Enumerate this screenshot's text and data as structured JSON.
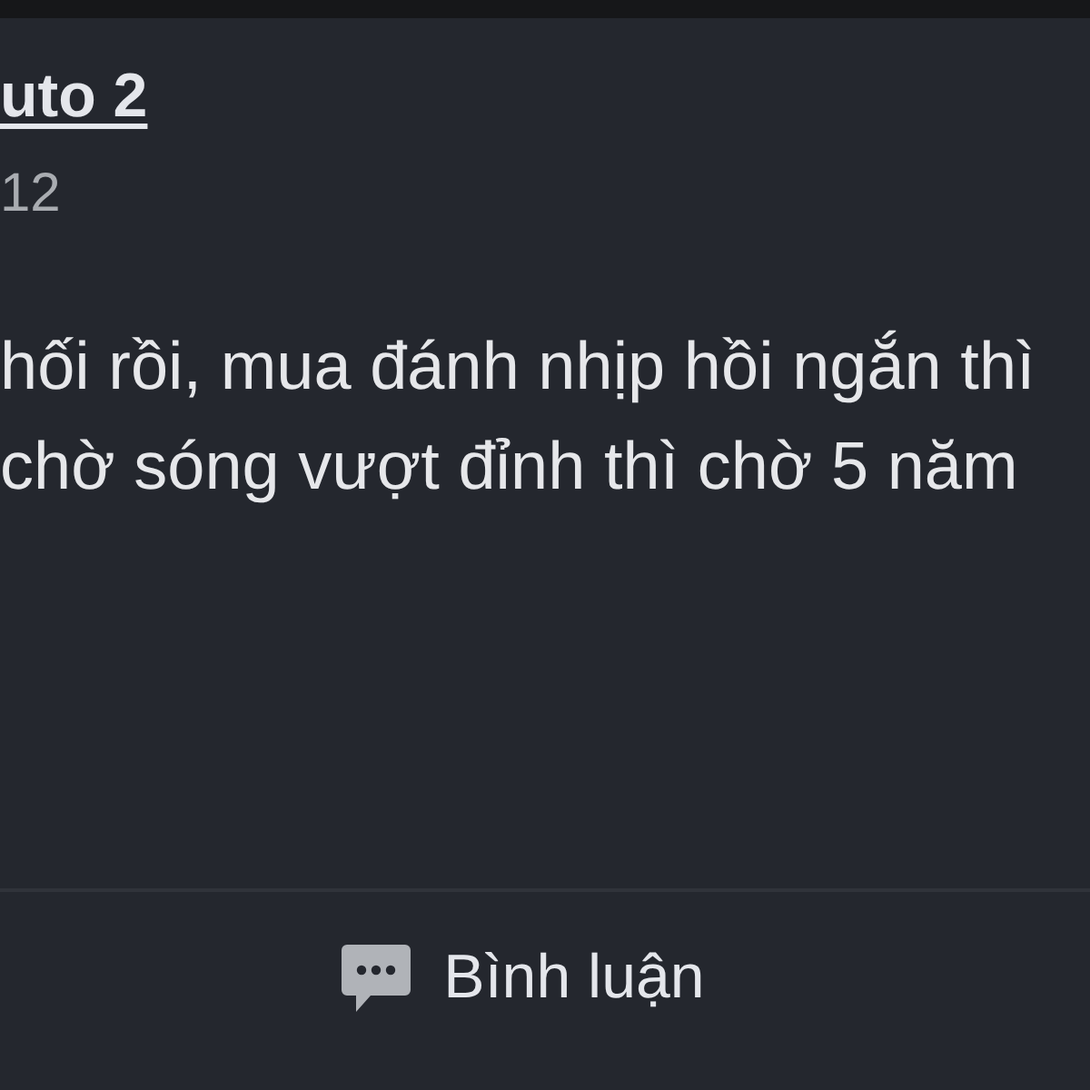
{
  "post": {
    "author": "uto 2",
    "time": "12",
    "text_lines": [
      "hối rồi, mua đánh nhịp hồi ngắn thì",
      "chờ sóng vượt đỉnh thì chờ 5 năm"
    ]
  },
  "actions": [
    {
      "kind": "comment",
      "label": "Bình luận"
    }
  ]
}
